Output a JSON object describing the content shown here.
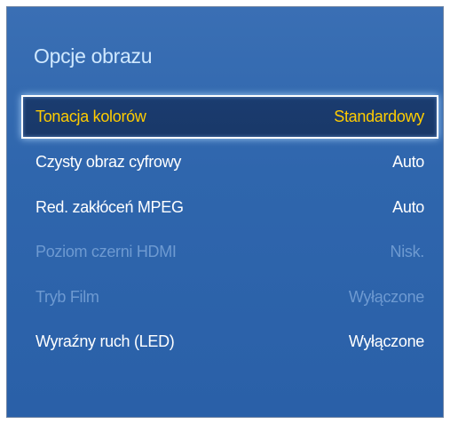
{
  "panel": {
    "title": "Opcje obrazu"
  },
  "menu": {
    "items": [
      {
        "label": "Tonacja kolorów",
        "value": "Standardowy",
        "state": "selected"
      },
      {
        "label": "Czysty obraz cyfrowy",
        "value": "Auto",
        "state": "enabled"
      },
      {
        "label": "Red. zakłóceń MPEG",
        "value": "Auto",
        "state": "enabled"
      },
      {
        "label": "Poziom czerni HDMI",
        "value": "Nisk.",
        "state": "disabled"
      },
      {
        "label": "Tryb Film",
        "value": "Wyłączone",
        "state": "disabled"
      },
      {
        "label": "Wyraźny ruch (LED)",
        "value": "Wyłączone",
        "state": "enabled"
      }
    ]
  },
  "colors": {
    "background": "#2f66ad",
    "title": "#cfe8ff",
    "selected_text": "#ffcc00",
    "normal_text": "#ffffff",
    "disabled_text": "#6e9ad1"
  }
}
